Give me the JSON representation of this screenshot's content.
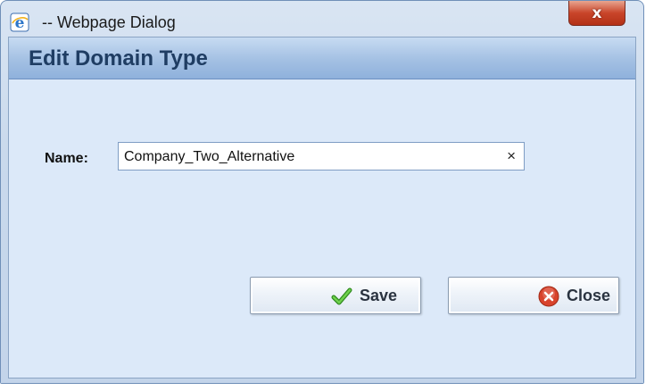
{
  "window": {
    "title": "-- Webpage Dialog",
    "close_label": "x"
  },
  "dialog": {
    "heading": "Edit Domain Type",
    "name_label": "Name:",
    "name_value": "Company_Two_Alternative",
    "clear_glyph": "×"
  },
  "buttons": {
    "save_label": "Save",
    "close_label": "Close"
  },
  "icons": {
    "browser": "internet-explorer-icon",
    "save": "checkmark-icon",
    "close": "cancel-circle-icon"
  },
  "colors": {
    "header_gradient": "#a3c0e3",
    "content_bg": "#dce9f9",
    "close_button": "#c9452a",
    "check_green": "#3ea32a",
    "cancel_red": "#d8432c"
  }
}
